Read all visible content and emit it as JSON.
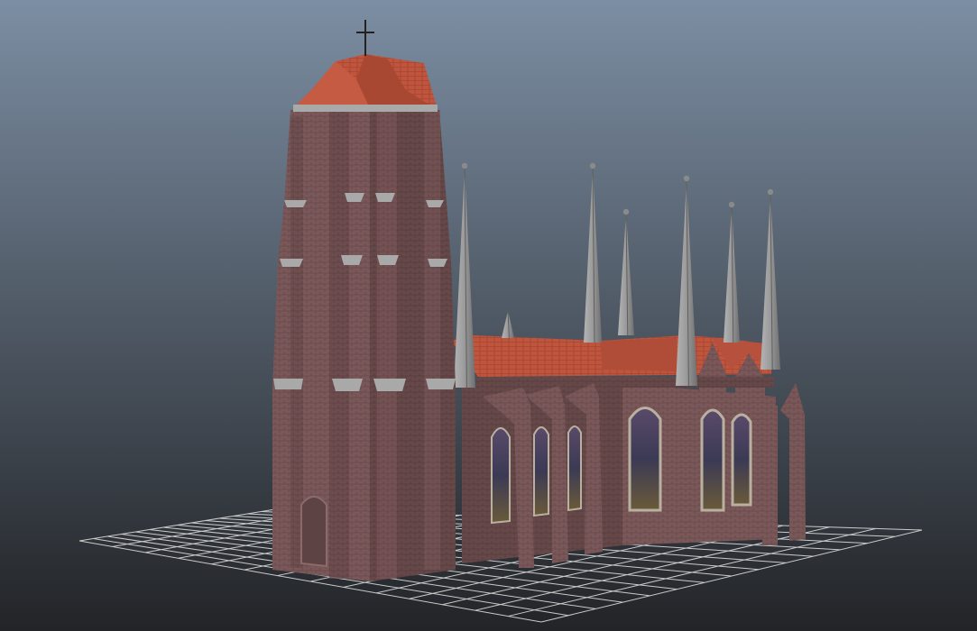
{
  "viewport": {
    "background_top": "#7c8ea3",
    "background_bottom": "#222427",
    "grid_color": "#e6e6e6"
  },
  "model": {
    "brick_color": "#7a5758",
    "brick_dark": "#5e4344",
    "brick_light": "#8d6a6a",
    "roof_color": "#c0553e",
    "roof_dark": "#9b3f2d",
    "spire_color": "#9a9a9a",
    "spire_dark": "#6f6f6f",
    "stone_trim": "#a9a9a9",
    "window_glass": "#3b3a55",
    "cross_icon": "cross-icon"
  }
}
